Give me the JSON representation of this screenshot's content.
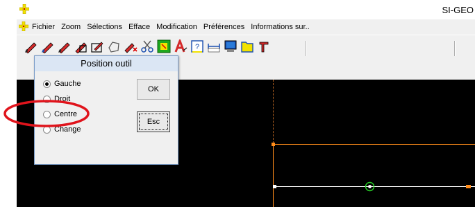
{
  "window": {
    "title": "SI-GEO"
  },
  "menu": {
    "items": [
      "Fichier",
      "Zoom",
      "Sélections",
      "Efface",
      "Modification",
      "Préférences",
      "Informations sur.."
    ]
  },
  "toolbar": {
    "buttons": [
      "pencil-red-icon",
      "pencil-blue-icon",
      "pencil-red-icon",
      "eraser-icon",
      "edit-shape-icon",
      "polygon-icon",
      "pencil-x-icon",
      "scissors-icon",
      "select-green-icon",
      "text-red-icon",
      "help-icon",
      "measure-icon",
      "monitor-icon",
      "folder-yellow-icon",
      "tool-icon"
    ]
  },
  "dialog": {
    "title": "Position outil",
    "options": [
      {
        "label": "Gauche",
        "selected": true
      },
      {
        "label": "Droit",
        "selected": false
      },
      {
        "label": "Centre",
        "selected": false
      },
      {
        "label": "Change",
        "selected": false
      }
    ],
    "ok_label": "OK",
    "esc_label": "Esc"
  },
  "colors": {
    "annotation": "#e0141c",
    "canvas": "#000000",
    "orange_line": "#ff8c1a",
    "dialog_title_bg": "#dbe6f4"
  }
}
